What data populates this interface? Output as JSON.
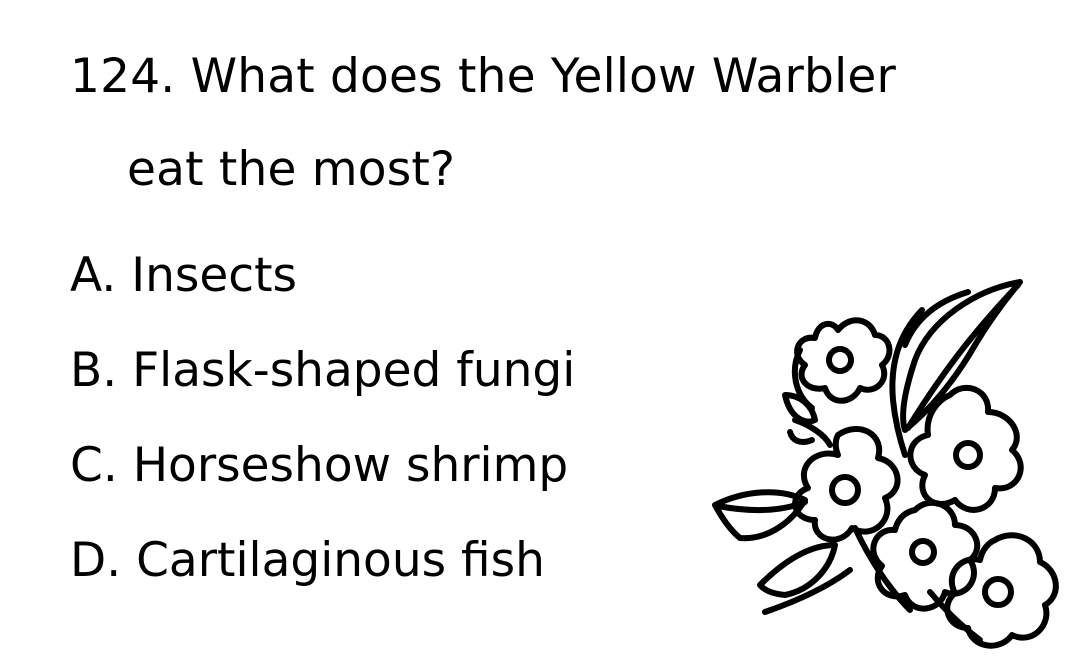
{
  "question": {
    "number": "124.",
    "text_line1": "What does the Yellow Warbler",
    "text_line2": "eat the most?"
  },
  "options": [
    {
      "letter": "A.",
      "text": "Insects"
    },
    {
      "letter": "B.",
      "text": "Flask-shaped fungi"
    },
    {
      "letter": "C.",
      "text": "Horseshow shrimp"
    },
    {
      "letter": "D.",
      "text": "Cartilaginous fish"
    }
  ],
  "illustration": {
    "icon": "flower-bouquet-icon",
    "line_color": "#000000",
    "background_color": "#ffffff"
  }
}
